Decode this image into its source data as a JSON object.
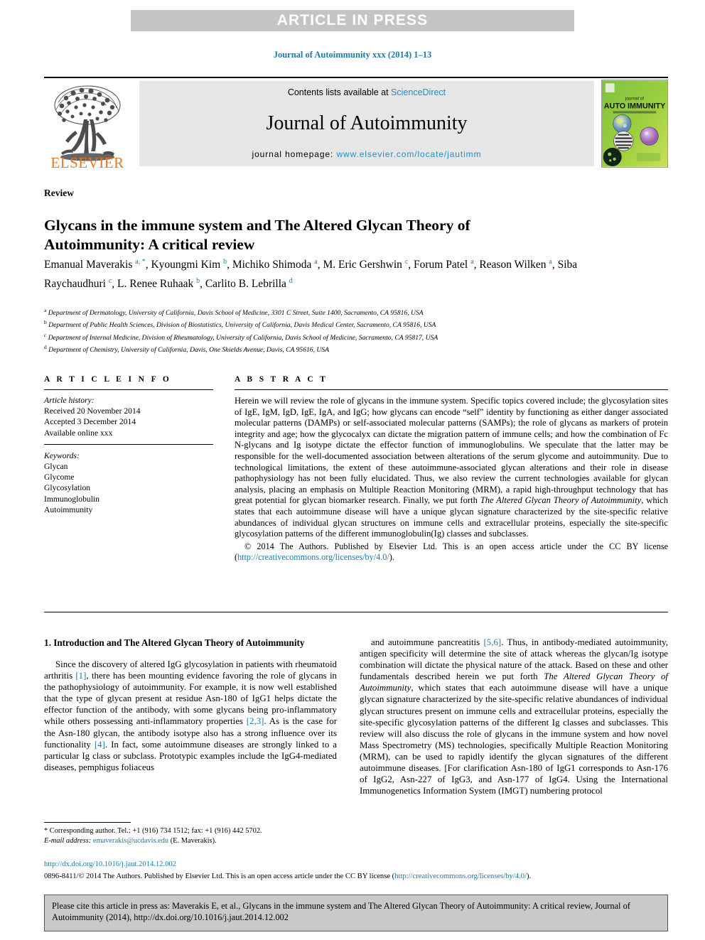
{
  "banner": {
    "text": "ARTICLE IN PRESS"
  },
  "running_head": "Journal of Autoimmunity xxx (2014) 1–13",
  "masthead": {
    "contents_prefix": "Contents lists available at ",
    "contents_link": "ScienceDirect",
    "journal_title": "Journal of Autoimmunity",
    "homepage_label": "journal homepage: ",
    "homepage_url": "www.elsevier.com/locate/jautimm",
    "publisher_logo": "ELSEVIER",
    "cover_line1": "journal of",
    "cover_line2": "AUTO IMMUNITY"
  },
  "article": {
    "type": "Review",
    "title": "Glycans in the immune system and The Altered Glycan Theory of Autoimmunity: A critical review",
    "authors_html": "Emanual Maverakis <sup>a, *</sup>, Kyoungmi Kim <sup>b</sup>, Michiko Shimoda <sup>a</sup>, M. Eric Gershwin <sup>c</sup>, Forum Patel <sup>a</sup>, Reason Wilken <sup>a</sup>, Siba Raychaudhuri <sup>c</sup>, L. Renee Ruhaak <sup>b</sup>, Carlito B. Lebrilla <sup>d</sup>",
    "affiliations": [
      {
        "mark": "a",
        "text": "Department of Dermatology, University of California, Davis School of Medicine, 3301 C Street, Suite 1400, Sacramento, CA 95816, USA"
      },
      {
        "mark": "b",
        "text": "Department of Public Health Sciences, Division of Biostatistics, University of California, Davis Medical Center, Sacramento, CA 95816, USA"
      },
      {
        "mark": "c",
        "text": "Department of Internal Medicine, Division of Rheumatology, University of California, Davis School of Medicine, Sacramento, CA 95817, USA"
      },
      {
        "mark": "d",
        "text": "Department of Chemistry, University of California, Davis, One Shields Avenue, Davis, CA 95616, USA"
      }
    ]
  },
  "info": {
    "label": "A R T I C L E  I N F O",
    "history_label": "Article history:",
    "history": [
      "Received 20 November 2014",
      "Accepted 3 December 2014",
      "Available online xxx"
    ],
    "keywords_label": "Keywords:",
    "keywords": [
      "Glycan",
      "Glycome",
      "Glycosylation",
      "Immunoglobulin",
      "Autoimmunity"
    ]
  },
  "abstract": {
    "label": "A B S T R A C T",
    "part1": "Herein we will review the role of glycans in the immune system. Specific topics covered include; the glycosylation sites of IgE, IgM, IgD, IgE, IgA, and IgG; how glycans can encode “self” identity by functioning as either danger associated molecular patterns (DAMPs) or self-associated molecular patterns (SAMPs); the role of glycans as markers of protein integrity and age; how the glycocalyx can dictate the migration pattern of immune cells; and how the combination of Fc N-glycans and Ig isotype dictate the effector function of immunoglobulins. We speculate that the latter may be responsible for the well-documented association between alterations of the serum glycome and autoimmunity. Due to technological limitations, the extent of these autoimmune-associated glycan alterations and their role in disease pathophysiology has not been fully elucidated. Thus, we also review the current technologies available for glycan analysis, placing an emphasis on Multiple Reaction Monitoring (MRM), a rapid high-throughput technology that has great potential for glycan biomarker research. Finally, we put forth ",
    "theory_italic": "The Altered Glycan Theory of Autoimmunity",
    "part2": ", which states that each autoimmune disease will have a unique glycan signature characterized by the site-specific relative abundances of individual glycan structures on immune cells and extracellular proteins, especially the site-specific glycosylation patterns of the different immunoglobulin(Ig) classes and subclasses.",
    "copyright": "© 2014 The Authors. Published by Elsevier Ltd. This is an open access article under the CC BY license",
    "license_open": "(",
    "license_url": "http://creativecommons.org/licenses/by/4.0/",
    "license_close": ")."
  },
  "body": {
    "section_heading": "1. Introduction and The Altered Glycan Theory of Autoimmunity",
    "left_p1_a": "Since the discovery of altered IgG glycosylation in patients with rheumatoid arthritis ",
    "left_ref1": "[1]",
    "left_p1_b": ", there has been mounting evidence favoring the role of glycans in the pathophysiology of autoimmunity. For example, it is now well established that the type of glycan present at residue Asn-180 of IgG1 helps dictate the effector function of the antibody, with some glycans being pro-inflammatory while others possessing anti-inflammatory properties ",
    "left_ref2": "[2,3]",
    "left_p1_c": ". As is the case for the Asn-180 glycan, the antibody isotype also has a strong influence over its functionality ",
    "left_ref3": "[4]",
    "left_p1_d": ". In fact, some autoimmune diseases are strongly linked to a particular Ig class or subclass. Prototypic examples include the IgG4-mediated diseases, pemphigus foliaceus",
    "right_p1_a": "and autoimmune pancreatitis ",
    "right_ref1": "[5,6]",
    "right_p1_b": ". Thus, in antibody-mediated autoimmunity, antigen specificity will determine the site of attack whereas the glycan/Ig isotype combination will dictate the physical nature of the attack. Based on these and other fundamentals described herein we put forth ",
    "right_italic": "The Altered Glycan Theory of Autoimmunity",
    "right_p1_c": ", which states that each autoimmune disease will have a unique glycan signature characterized by the site-specific relative abundances of individual glycan structures present on immune cells and extracellular proteins, especially the site-specific glycosylation patterns of the different Ig classes and subclasses. This review will also discuss the role of glycans in the immune system and how novel Mass Spectrometry (MS) technologies, specifically Multiple Reaction Monitoring (MRM), can be used to rapidly identify the glycan signatures of the different autoimmune diseases. [For clarification Asn-180 of IgG1 corresponds to Asn-176 of IgG2, Asn-227 of IgG3, and Asn-177 of IgG4. Using the International Immunogenetics Information System (IMGT) numbering protocol"
  },
  "footnote": {
    "star": "*",
    "corresponding": " Corresponding author. Tel.: +1 (916) 734 1512; fax: +1 (916) 442 5702.",
    "email_label": "E-mail address:",
    "email": "emaverakis@ucdavis.edu",
    "email_suffix": " (E. Maverakis)."
  },
  "footer": {
    "doi": "http://dx.doi.org/10.1016/j.jaut.2014.12.002",
    "issn_prefix": "0896-8411/© 2014 The Authors. Published by Elsevier Ltd. This is an open access article under the CC BY license (",
    "issn_link": "http://creativecommons.org/licenses/by/4.0/",
    "issn_suffix": ")."
  },
  "cite_box": {
    "text": "Please cite this article in press as: Maverakis E, et al., Glycans in the immune system and The Altered Glycan Theory of Autoimmunity: A critical review, Journal of Autoimmunity (2014), http://dx.doi.org/10.1016/j.jaut.2014.12.002"
  },
  "colors": {
    "link": "#1a7ba6",
    "banner_bg": "#c3c4c6",
    "masthead_bg": "#e6e6e6",
    "cite_bg": "#c9c9c9",
    "elsevier_orange": "#e87722"
  }
}
